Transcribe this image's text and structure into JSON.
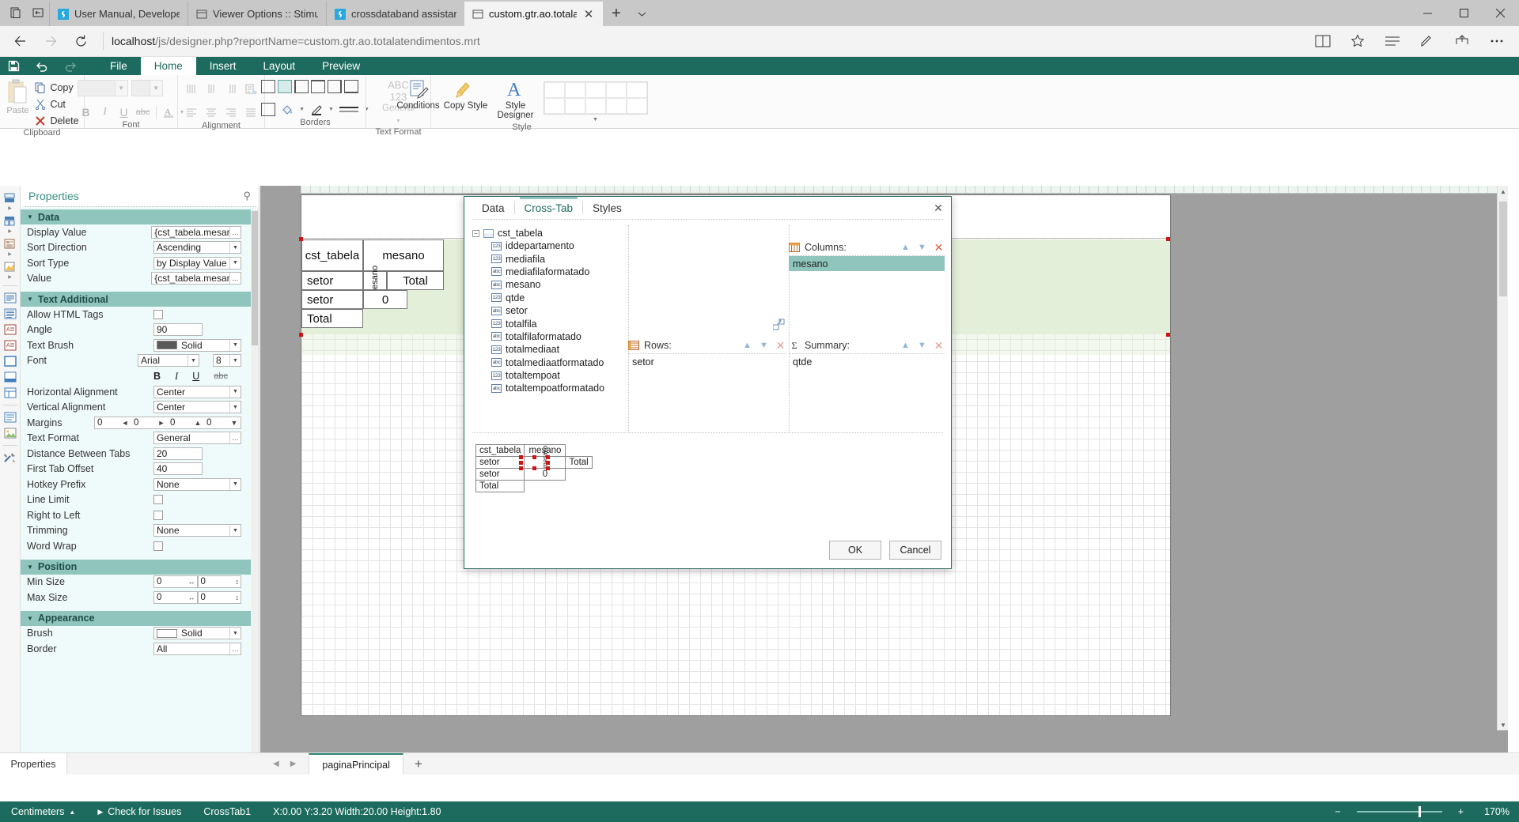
{
  "browser": {
    "tabs": [
      {
        "title": "User Manual, Developer FAQ",
        "icon": "stimulsoft-favicon",
        "active": false
      },
      {
        "title": "Viewer Options :: Stimulsoft",
        "icon": "window-favicon",
        "active": false
      },
      {
        "title": "crossdataband assistance • ",
        "icon": "stimulsoft-favicon",
        "active": false
      },
      {
        "title": "custom.gtr.ao.totalatend",
        "icon": "window-favicon",
        "active": true
      }
    ],
    "new_tab_label": "+",
    "url_host": "localhost",
    "url_path": "/js/designer.php?reportName=custom.gtr.ao.totalatendimentos.mrt",
    "window_controls": [
      "minimize",
      "maximize",
      "close"
    ]
  },
  "ribbon": {
    "tabs": [
      {
        "label": "File",
        "active": false
      },
      {
        "label": "Home",
        "active": true
      },
      {
        "label": "Insert",
        "active": false
      },
      {
        "label": "Layout",
        "active": false
      },
      {
        "label": "Preview",
        "active": false
      }
    ],
    "quick_access": [
      "save-icon",
      "undo-icon",
      "redo-icon"
    ],
    "groups": [
      {
        "name": "Clipboard",
        "label": "Clipboard",
        "paste_label": "Paste",
        "items": [
          {
            "label": "Copy",
            "icon": "copy-icon"
          },
          {
            "label": "Cut",
            "icon": "scissors-icon"
          },
          {
            "label": "Delete",
            "icon": "delete-x-icon"
          }
        ]
      },
      {
        "name": "Font",
        "label": "Font",
        "bold": "B",
        "italic": "I",
        "underline": "U",
        "strike": "abc"
      },
      {
        "name": "Alignment",
        "label": "Alignment"
      },
      {
        "name": "Borders",
        "label": "Borders"
      },
      {
        "name": "TextFormat",
        "label": "Text Format",
        "sample_l1": "ABC",
        "sample_l2": "123",
        "sample_l3": "General"
      },
      {
        "name": "Style",
        "label": "Style",
        "items": [
          {
            "label": "Conditions",
            "icon": "conditions-icon"
          },
          {
            "label": "Copy Style",
            "icon": "brush-icon"
          },
          {
            "label": "Style Designer",
            "icon": "style-a-icon"
          }
        ]
      }
    ]
  },
  "properties": {
    "title": "Properties",
    "pin_icon": "pin-icon",
    "sections": [
      {
        "title": "Data",
        "rows": [
          {
            "label": "Display Value",
            "value": "{cst_tabela.mesano}",
            "type": "text-ellipsis"
          },
          {
            "label": "Sort Direction",
            "value": "Ascending",
            "type": "select"
          },
          {
            "label": "Sort Type",
            "value": "by Display Value",
            "type": "select"
          },
          {
            "label": "Value",
            "value": "{cst_tabela.mesano}",
            "type": "text-ellipsis"
          }
        ]
      },
      {
        "title": "Text Additional",
        "rows": [
          {
            "label": "Allow HTML Tags",
            "value": "",
            "type": "checkbox",
            "checked": false
          },
          {
            "label": "Angle",
            "value": "90",
            "type": "text-small"
          },
          {
            "label": "Text Brush",
            "value": "Solid",
            "type": "brush",
            "color": "#595959"
          },
          {
            "label": "Font",
            "value": "Arial",
            "type": "font",
            "size": "8"
          },
          {
            "label": "",
            "value": "",
            "type": "font-style-row"
          },
          {
            "label": "Horizontal Alignment",
            "value": "Center",
            "type": "select"
          },
          {
            "label": "Vertical Alignment",
            "value": "Center",
            "type": "select"
          },
          {
            "label": "Margins",
            "value": "0 0 0 0",
            "type": "margins",
            "m": [
              "0",
              "0",
              "0",
              "0"
            ]
          },
          {
            "label": "Text Format",
            "value": "General",
            "type": "text-ellipsis"
          },
          {
            "label": "Distance Between Tabs",
            "value": "20",
            "type": "text-small"
          },
          {
            "label": "First Tab Offset",
            "value": "40",
            "type": "text-small"
          },
          {
            "label": "Hotkey Prefix",
            "value": "None",
            "type": "select"
          },
          {
            "label": "Line Limit",
            "value": "",
            "type": "checkbox",
            "checked": false
          },
          {
            "label": "Right to Left",
            "value": "",
            "type": "checkbox",
            "checked": false
          },
          {
            "label": "Trimming",
            "value": "None",
            "type": "select"
          },
          {
            "label": "Word Wrap",
            "value": "",
            "type": "checkbox",
            "checked": false
          }
        ]
      },
      {
        "title": "Position",
        "rows": [
          {
            "label": "Min Size",
            "value": "0",
            "value2": "0",
            "type": "pair"
          },
          {
            "label": "Max Size",
            "value": "0",
            "value2": "0",
            "type": "pair"
          }
        ]
      },
      {
        "title": "Appearance",
        "rows": [
          {
            "label": "Brush",
            "value": "Solid",
            "type": "brush",
            "color": "#ffffff"
          },
          {
            "label": "Border",
            "value": "All",
            "type": "text-ellipsis"
          }
        ]
      }
    ]
  },
  "canvas": {
    "cells": [
      {
        "text": "cst_tabela"
      },
      {
        "text": "mesano"
      },
      {
        "text": "setor"
      },
      {
        "text": "Total"
      },
      {
        "text": "setor"
      },
      {
        "text": "0"
      },
      {
        "text": "Total"
      }
    ]
  },
  "dialog": {
    "tabs": [
      {
        "label": "Data",
        "active": false
      },
      {
        "label": "Cross-Tab",
        "active": true
      },
      {
        "label": "Styles",
        "active": false
      }
    ],
    "close_icon": "close-icon",
    "datasource": {
      "name": "cst_tabela",
      "expanded": true,
      "fields": [
        {
          "name": "iddepartamento",
          "type": "123"
        },
        {
          "name": "mediafila",
          "type": "123"
        },
        {
          "name": "mediafilaformatado",
          "type": "abc"
        },
        {
          "name": "mesano",
          "type": "abc"
        },
        {
          "name": "qtde",
          "type": "123"
        },
        {
          "name": "setor",
          "type": "abc"
        },
        {
          "name": "totalfila",
          "type": "123"
        },
        {
          "name": "totalfilaformatado",
          "type": "abc"
        },
        {
          "name": "totalmediaat",
          "type": "123"
        },
        {
          "name": "totalmediaatformatado",
          "type": "abc"
        },
        {
          "name": "totaltempoat",
          "type": "123"
        },
        {
          "name": "totaltempoatformatado",
          "type": "abc"
        }
      ]
    },
    "panels": {
      "columns": {
        "title": "Columns:",
        "icon": "columns-icon",
        "items": [
          {
            "label": "mesano",
            "selected": true
          }
        ]
      },
      "rows": {
        "title": "Rows:",
        "icon": "rows-icon",
        "items": [
          {
            "label": "setor",
            "selected": false
          }
        ]
      },
      "summary": {
        "title": "Summary:",
        "icon": "sigma-icon",
        "items": [
          {
            "label": "qtde",
            "selected": false
          }
        ]
      }
    },
    "preview": {
      "header": [
        "cst_tabela",
        "mesano"
      ],
      "rows": [
        [
          "setor",
          "mesano",
          "Total"
        ],
        [
          "setor",
          "0",
          ""
        ],
        [
          "Total",
          "",
          ""
        ]
      ]
    },
    "buttons": {
      "ok": "OK",
      "cancel": "Cancel"
    }
  },
  "pagebar": {
    "properties_tab": "Properties",
    "page_tab": "paginaPrincipal",
    "add_label": "+"
  },
  "statusbar": {
    "units": "Centimeters",
    "check_issues": "Check for Issues",
    "selected_object": "CrossTab1",
    "coords": "X:0.00 Y:3.20 Width:20.00 Height:1.80",
    "zoom": "170%",
    "zoom_out": "−",
    "zoom_in": "+"
  },
  "colors": {
    "accent": "#1d6b5f",
    "section_header": "#8fc5bd",
    "panel_bg": "#effbfa"
  }
}
